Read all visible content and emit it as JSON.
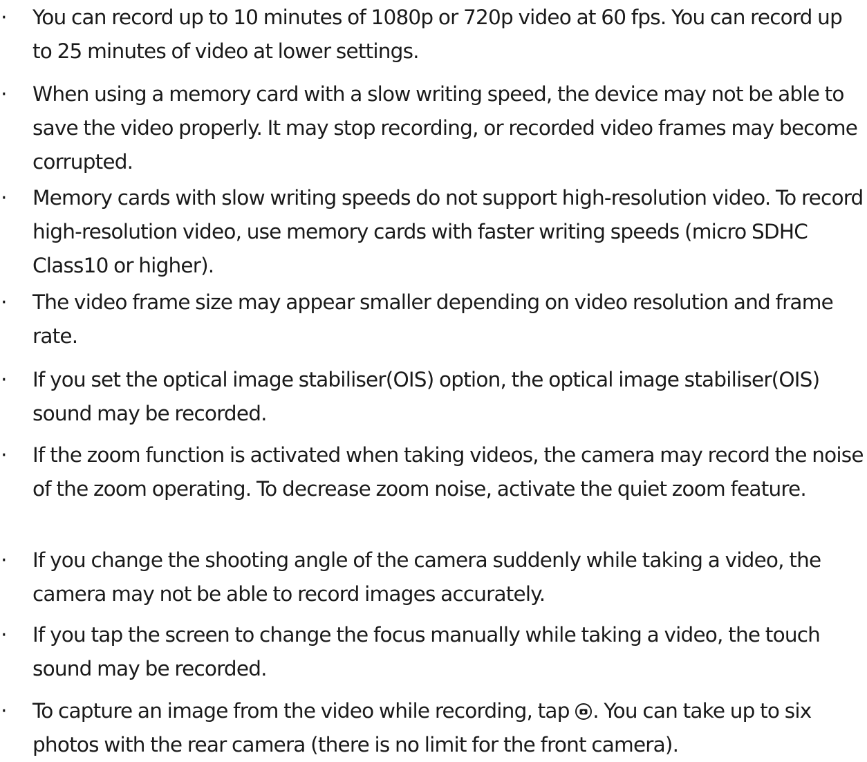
{
  "notes": [
    {
      "text": "You can record up to 10 minutes of 1080p or 720p video at 60 fps. You can record up to 25 minutes of video at lower settings."
    },
    {
      "text": "When using a memory card with a slow writing speed, the device may not be able to save the video properly. It may stop recording, or recorded video frames may become corrupted."
    },
    {
      "text": "Memory cards with slow writing speeds do not support high-resolution video. To record high-resolution video, use memory cards with faster writing speeds (micro SDHC Class10 or higher)."
    },
    {
      "text": "The video frame size may appear smaller depending on video resolution and frame rate."
    },
    {
      "text": "If you set the optical image stabiliser(OIS) option, the optical image stabiliser(OIS) sound may be recorded."
    },
    {
      "text": "If the zoom function is activated when taking videos, the camera may record the noise of the zoom operating. To decrease zoom noise, activate the quiet zoom feature."
    },
    {
      "text": "If you change the shooting angle of the camera suddenly while taking a video, the camera may not be able to record images accurately."
    },
    {
      "text": "If you tap the screen to change the focus manually while taking a video, the touch sound may be recorded."
    },
    {
      "text_before": "To capture an image from the video while recording, tap ",
      "icon": "camera-capture-icon",
      "text_after": ". You can take up to six photos with the rear camera (there is no limit for the front camera)."
    }
  ]
}
